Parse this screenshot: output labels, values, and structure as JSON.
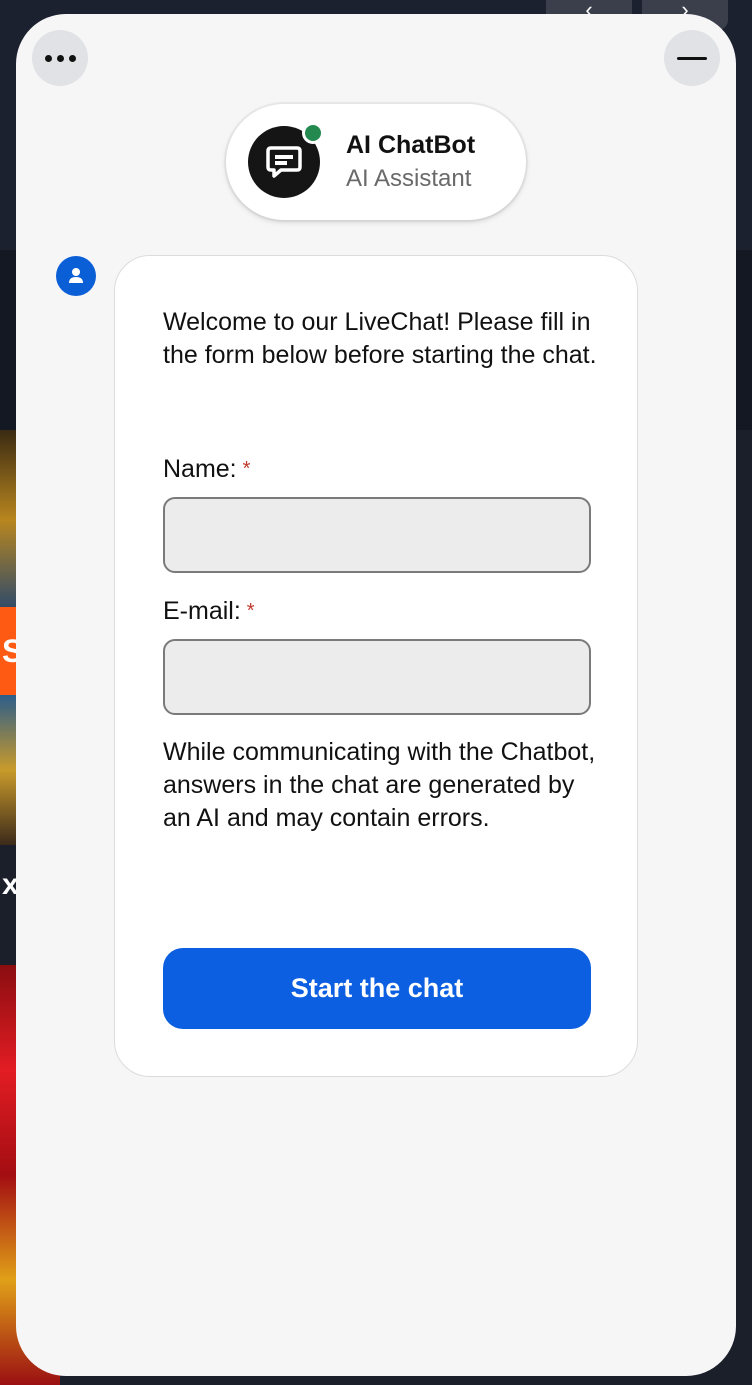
{
  "background": {
    "fragment_letter": "S",
    "fragment_close": "x",
    "nav_prev": "‹",
    "nav_next": "›"
  },
  "header": {
    "bot_name": "AI ChatBot",
    "bot_role": "AI Assistant",
    "status": "online"
  },
  "form": {
    "intro": "Welcome to our LiveChat! Please fill in the form below before starting the chat.",
    "name_label": "Name:",
    "name_value": "",
    "email_label": "E-mail:",
    "email_value": "",
    "required_mark": "*",
    "disclaimer": "While communicating with the Chatbot, answers in the chat are generated by an AI and may contain errors.",
    "submit_label": "Start the chat"
  },
  "colors": {
    "accent": "#0b5fe0",
    "online": "#23894f",
    "required": "#c0392b"
  },
  "icons": {
    "menu": "more-dots-icon",
    "minimize": "minimize-icon",
    "bot": "chat-bubble-icon",
    "user": "user-icon"
  }
}
